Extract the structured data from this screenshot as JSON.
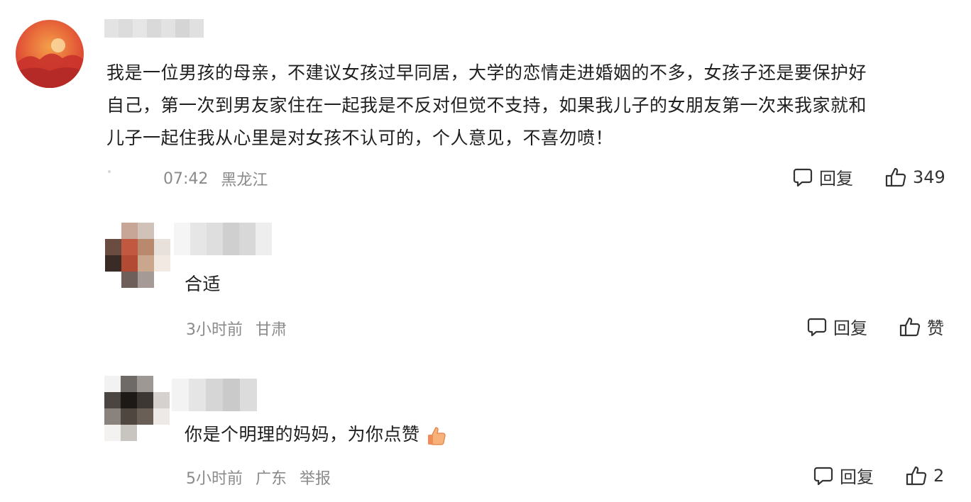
{
  "comments": [
    {
      "text_lines": [
        "我是一位男孩的母亲，不建议女孩过早同居，大学的恋情走进婚姻的不多，女孩子还是要保护好",
        "自己，第一次到男友家住在一起我是不反对但觉不支持，如果我儿子的女朋友第一次来我家就和",
        "儿子一起住我从心里是对女孩不认可的，个人意见，不喜勿喷！"
      ],
      "time": "07:42",
      "location": "黑龙江",
      "reply_label": "回复",
      "like_label": "349"
    },
    {
      "text": "合适",
      "time": "3小时前",
      "location": "甘肃",
      "reply_label": "回复",
      "like_label": "赞"
    },
    {
      "text": "你是个明理的妈妈，为你点赞",
      "emoji_icon": "thumbs-up-emoji",
      "time": "5小时前",
      "location": "广东",
      "report_label": "举报",
      "reply_label": "回复",
      "like_label": "2"
    }
  ],
  "colors": {
    "text": "#1f1f1f",
    "meta": "#8a8a8a",
    "avatar_red": "#e04a36",
    "avatar_orange": "#f08a3c"
  }
}
